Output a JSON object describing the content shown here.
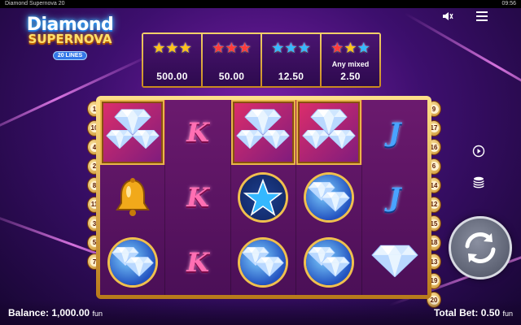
{
  "system_bar": {
    "title": "Diamond Supernova 20",
    "time": "09:56"
  },
  "logo": {
    "line1": "Diamond",
    "line2": "SUPERNOVA",
    "badge": "20 LINES"
  },
  "icons": {
    "sound": "speaker-icon",
    "menu": "hamburger-menu-icon",
    "autoplay": "autoplay-icon",
    "bet": "coin-stack-icon",
    "spin": "spin-arrows-icon"
  },
  "paytable": [
    {
      "stars": [
        "gold",
        "gold",
        "gold"
      ],
      "label": "",
      "value": "500.00"
    },
    {
      "stars": [
        "red",
        "red",
        "red"
      ],
      "label": "",
      "value": "50.00"
    },
    {
      "stars": [
        "blue",
        "blue",
        "blue"
      ],
      "label": "",
      "value": "12.50"
    },
    {
      "stars": [
        "red",
        "gold",
        "blue"
      ],
      "label": "Any mixed",
      "value": "2.50"
    }
  ],
  "star_colors": {
    "gold": "#ffc21a",
    "red": "#ff3b3b",
    "blue": "#35b8ff"
  },
  "reels": [
    [
      "diamond-triple",
      "k",
      "diamond-triple",
      "diamond-triple",
      "j"
    ],
    [
      "bell",
      "k",
      "blue-star",
      "diamond-orb",
      "j"
    ],
    [
      "diamond-orb",
      "k",
      "diamond-orb",
      "diamond-orb",
      "diamond"
    ]
  ],
  "letters": {
    "k": "K",
    "j": "J"
  },
  "lines_left": [
    "1",
    "10",
    "4",
    "2",
    "8",
    "11",
    "3",
    "5",
    "7"
  ],
  "lines_right": [
    "9",
    "17",
    "16",
    "6",
    "14",
    "12",
    "15",
    "18",
    "13",
    "19",
    "20"
  ],
  "footer": {
    "balance_label": "Balance:",
    "balance_value": "1,000.00",
    "balance_unit": "fun",
    "bet_label": "Total Bet:",
    "bet_value": "0.50",
    "bet_unit": "fun"
  }
}
